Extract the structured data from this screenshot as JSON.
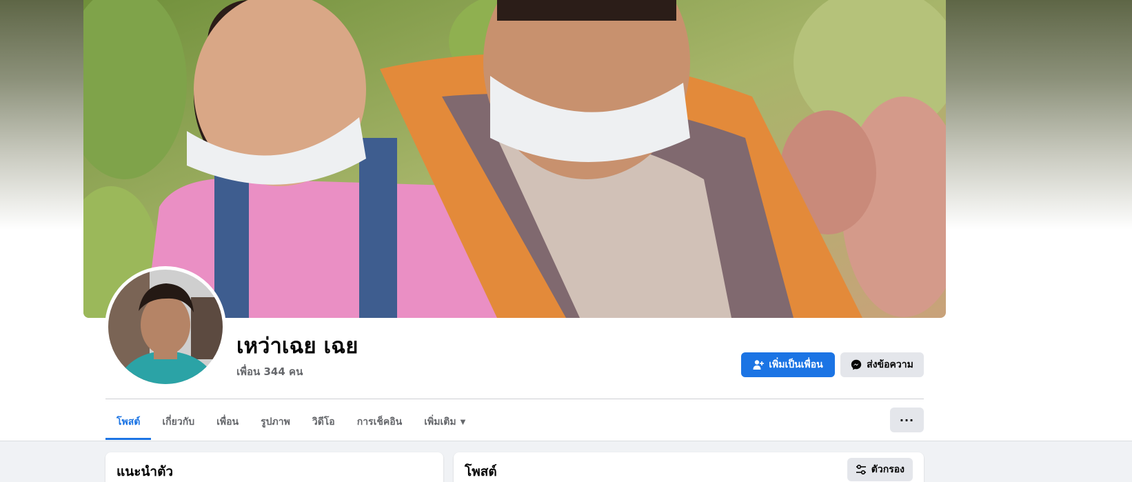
{
  "profile": {
    "name": "เหว่าเฉย เฉย",
    "friends_text": "เพื่อน 344 คน"
  },
  "actions": {
    "add_friend_label": "เพิ่มเป็นเพื่อน",
    "message_label": "ส่งข้อความ",
    "more_label": "···"
  },
  "tabs": [
    {
      "label": "โพสต์",
      "active": true
    },
    {
      "label": "เกี่ยวกับ",
      "active": false
    },
    {
      "label": "เพื่อน",
      "active": false
    },
    {
      "label": "รูปภาพ",
      "active": false
    },
    {
      "label": "วิดีโอ",
      "active": false
    },
    {
      "label": "การเช็คอิน",
      "active": false
    },
    {
      "label": "เพิ่มเติม",
      "active": false
    }
  ],
  "intro_card": {
    "title": "แนะนำตัว"
  },
  "posts_card": {
    "title": "โพสต์",
    "filter_label": "ตัวกรอง"
  },
  "icons": {
    "add_friend": "person-add-icon",
    "message": "messenger-icon",
    "more_tab": "caret-down-icon",
    "filter": "filter-sliders-icon"
  },
  "colors": {
    "accent": "#1b74e4",
    "secondary_button": "#e4e6eb",
    "muted_text": "#65676b",
    "page_background": "#f0f2f5"
  }
}
